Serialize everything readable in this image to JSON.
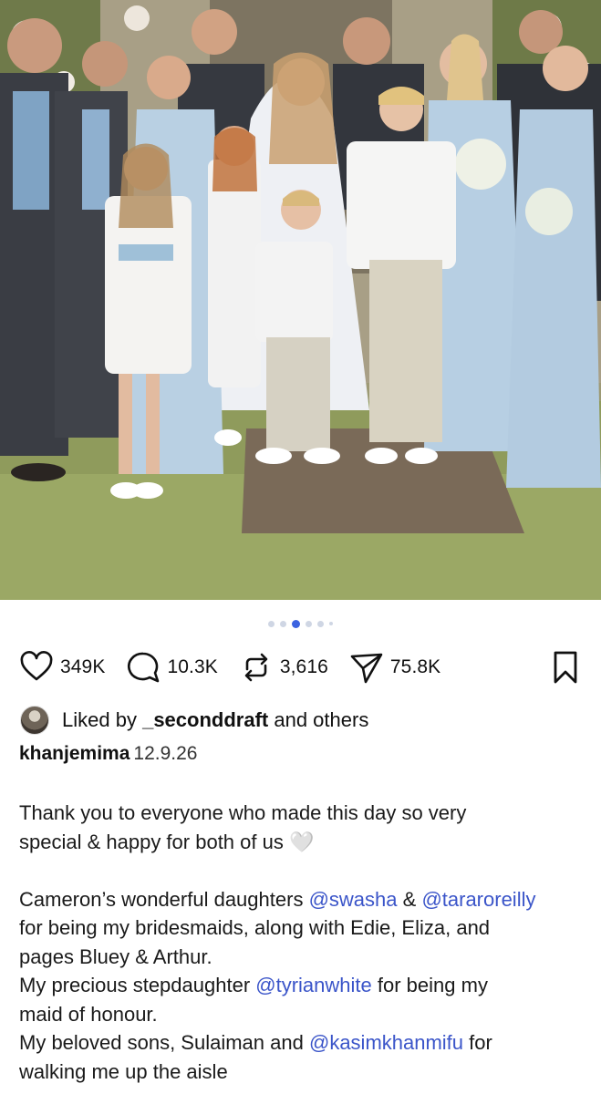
{
  "post": {
    "carousel": {
      "total": 6,
      "active_index": 2
    },
    "actions": {
      "likes": "349K",
      "comments": "10.3K",
      "reposts": "3,616",
      "shares": "75.8K"
    },
    "liked_by": {
      "prefix": "Liked by",
      "user": "_seconddraft",
      "suffix": "and others"
    },
    "author": "khanjemima",
    "date": "12.9.26",
    "caption": {
      "p1_l1": "Thank you to everyone who made this day so very",
      "p1_l2": "special & happy for both of us",
      "p1_emoji": "🤍",
      "p2_l1_a": "Cameron’s wonderful daughters",
      "p2_l1_m1": "@swasha",
      "p2_l1_amp": "&",
      "p2_l1_m2": "@tararoreilly",
      "p2_l2": "for being my bridesmaids, along with Edie, Eliza, and",
      "p2_l3": "pages Bluey & Arthur.",
      "p2_l4_a": "My precious stepdaughter",
      "p2_l4_m": "@tyrianwhite",
      "p2_l4_b": "for being my",
      "p2_l5": "maid of honour.",
      "p2_l6_a": "My beloved sons, Sulaiman and",
      "p2_l6_m": "@kasimkhanmifu",
      "p2_l6_b": "for",
      "p2_l7": "walking me up the aisle"
    }
  },
  "colors": {
    "accent": "#3b63e0",
    "mention": "#3b55c9",
    "text": "#111111"
  }
}
